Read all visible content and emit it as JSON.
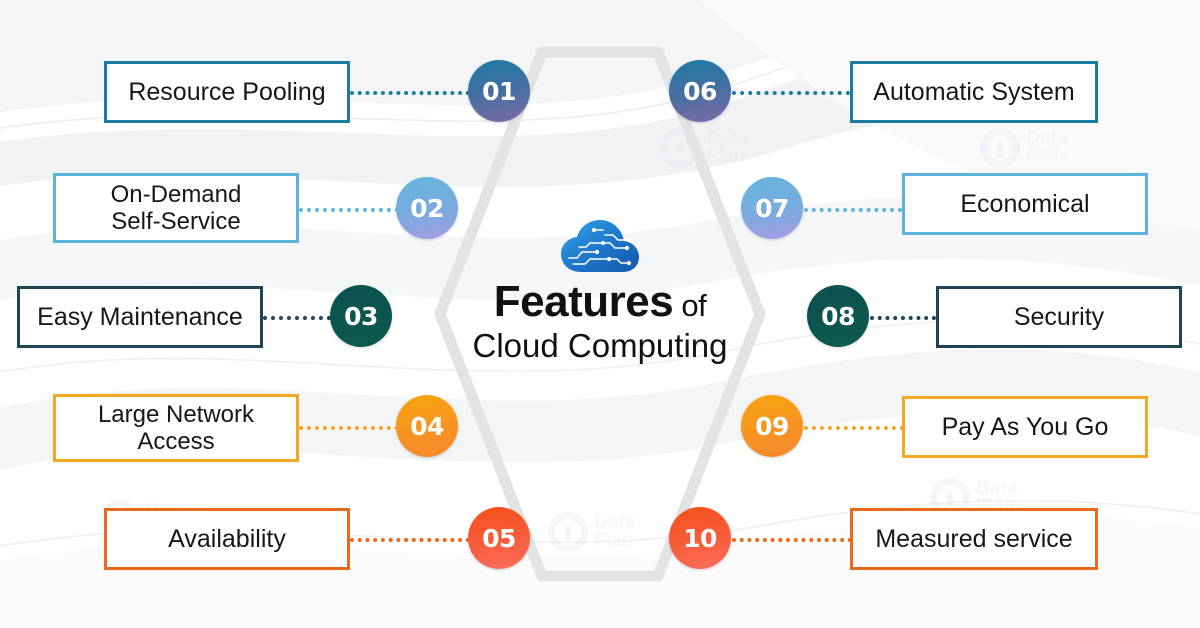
{
  "title": {
    "main": "Features",
    "connector_word": "of",
    "subject": "Cloud Computing"
  },
  "icons": {
    "center": "cloud-circuit-icon"
  },
  "watermark": {
    "line1": "Data",
    "line2": "Flair"
  },
  "colors": {
    "row1_accent": "#1b7ba0",
    "row2_accent": "#5cb4dc",
    "row3_accent": "#1f4455",
    "row4_accent": "#f5a623",
    "row5_accent": "#ea6a1d",
    "node1_top": "#1c7ba4",
    "node1_bottom": "#8a6fa8",
    "node2_top": "#63b4dd",
    "node2_bottom": "#9a9be0",
    "node3_top": "#0d4f4d",
    "node3_bottom": "#0f5b4e",
    "node4_top": "#f7a013",
    "node4_bottom": "#f68b2c",
    "node5_top": "#f4511e",
    "node5_bottom": "#fa6d5a",
    "hexagon": "#e2e2e2",
    "text": "#17171a",
    "background": "#ffffff"
  },
  "nodes": [
    {
      "id": "01",
      "side": "left",
      "row": 1
    },
    {
      "id": "02",
      "side": "left",
      "row": 2
    },
    {
      "id": "03",
      "side": "left",
      "row": 3
    },
    {
      "id": "04",
      "side": "left",
      "row": 4
    },
    {
      "id": "05",
      "side": "left",
      "row": 5
    },
    {
      "id": "06",
      "side": "right",
      "row": 1
    },
    {
      "id": "07",
      "side": "right",
      "row": 2
    },
    {
      "id": "08",
      "side": "right",
      "row": 3
    },
    {
      "id": "09",
      "side": "right",
      "row": 4
    },
    {
      "id": "10",
      "side": "right",
      "row": 5
    }
  ],
  "features": {
    "left": [
      {
        "number": "01",
        "label": "Resource Pooling"
      },
      {
        "number": "02",
        "label": "On-Demand\nSelf-Service"
      },
      {
        "number": "03",
        "label": "Easy Maintenance"
      },
      {
        "number": "04",
        "label": "Large Network\nAccess"
      },
      {
        "number": "05",
        "label": "Availability"
      }
    ],
    "right": [
      {
        "number": "06",
        "label": "Automatic System"
      },
      {
        "number": "07",
        "label": "Economical"
      },
      {
        "number": "08",
        "label": "Security"
      },
      {
        "number": "09",
        "label": "Pay As You Go"
      },
      {
        "number": "10",
        "label": "Measured service"
      }
    ]
  }
}
